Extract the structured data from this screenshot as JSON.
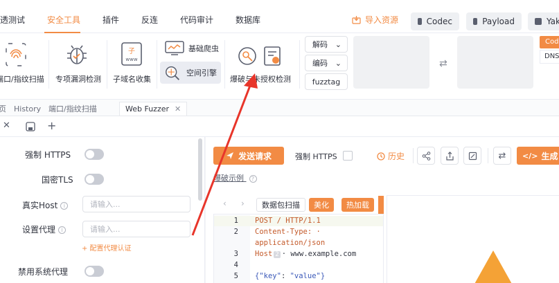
{
  "menubar": {
    "items": [
      "透测试",
      "安全工具",
      "插件",
      "反连",
      "代码审计",
      "数据库"
    ],
    "active_index": 1,
    "import_label": "导入资源",
    "codec_label": "Codec",
    "payload_label": "Payload",
    "yak_label": "Yak"
  },
  "ribbon": {
    "port_scan_label": "端口/指纹扫描",
    "vuln_detect_label": "专项漏洞检测",
    "subdomain_label": "子域名收集",
    "basic_crawler_label": "基础爬虫",
    "space_engine_label": "空间引擎",
    "brute_auth_label": "爆破与未授权检测",
    "decode_label": "解码",
    "encode_label": "编码",
    "fuzztag_label": "fuzztag",
    "cod_label": "Cod",
    "dns_label": "DNS"
  },
  "tabs": {
    "first_label": "页",
    "history_label": "History",
    "port_scan_tab_label": "端口/指纹扫描",
    "fuzzer_label": "Web Fuzzer"
  },
  "config": {
    "force_https_label": "强制 HTTPS",
    "gm_tls_label": "国密TLS",
    "real_host_label": "真实Host",
    "real_host_placeholder": "请输入...",
    "proxy_label": "设置代理",
    "proxy_placeholder": "请输入...",
    "proxy_auth_label": "+ 配置代理认证",
    "disable_sys_proxy_label": "禁用系统代理"
  },
  "request": {
    "send_label": "发送请求",
    "force_https_label": "强制 HTTPS",
    "history_label": "历史",
    "generate_label": "生成 Y",
    "example_label": "爆破示例",
    "packet_scan_label": "数据包扫描",
    "beautify_label": "美化",
    "hot_load_label": "热加载"
  },
  "editor": {
    "lines": [
      {
        "num": "1",
        "text": "POST / HTTP/1.1"
      },
      {
        "num": "2",
        "text": "Content-Type: application/json"
      },
      {
        "num": "3",
        "text": "Host: www.example.com"
      },
      {
        "num": "4",
        "text": ""
      },
      {
        "num": "5",
        "text": "{\"key\": \"value\"}"
      }
    ],
    "line2_part1": "Content-Type: ·",
    "line2_part2": "application/json",
    "line3_host": "Host",
    "line3_badge": "2",
    "line3_value": "· www.example.com",
    "line5_key": "{\"key\"",
    "line5_colon": ": ",
    "line5_value": "\"value\"}"
  },
  "colors": {
    "accent": "#f28b44",
    "code_keyword": "#c45a2a",
    "code_string": "#3a58b8"
  }
}
